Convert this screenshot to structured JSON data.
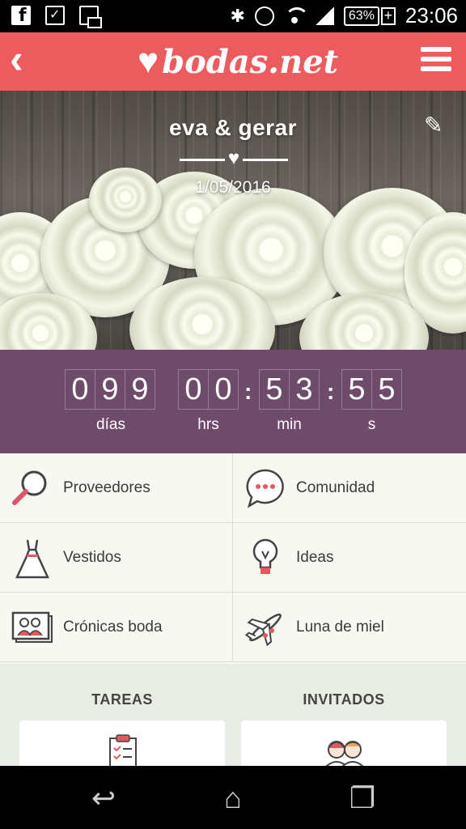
{
  "status_bar": {
    "battery": "63%",
    "time": "23:06"
  },
  "app_bar": {
    "logo_text": "bodas.net",
    "accent_color": "#ec5c5e"
  },
  "hero": {
    "couple": "eva & gerar",
    "date": "1/05/2016"
  },
  "countdown": {
    "days": [
      "0",
      "9",
      "9"
    ],
    "hours": [
      "0",
      "0"
    ],
    "minutes": [
      "5",
      "3"
    ],
    "seconds": [
      "5",
      "5"
    ],
    "labels": {
      "days": "días",
      "hours": "hrs",
      "minutes": "min",
      "seconds": "s"
    },
    "bg_color": "#6e4a6b"
  },
  "menu": [
    {
      "label": "Proveedores",
      "icon": "magnifier-icon"
    },
    {
      "label": "Comunidad",
      "icon": "chat-bubble-icon"
    },
    {
      "label": "Vestidos",
      "icon": "dress-icon"
    },
    {
      "label": "Ideas",
      "icon": "lightbulb-icon"
    },
    {
      "label": "Crónicas boda",
      "icon": "photos-icon"
    },
    {
      "label": "Luna de miel",
      "icon": "airplane-icon"
    }
  ],
  "sections": {
    "tasks": "TAREAS",
    "guests": "INVITADOS"
  }
}
